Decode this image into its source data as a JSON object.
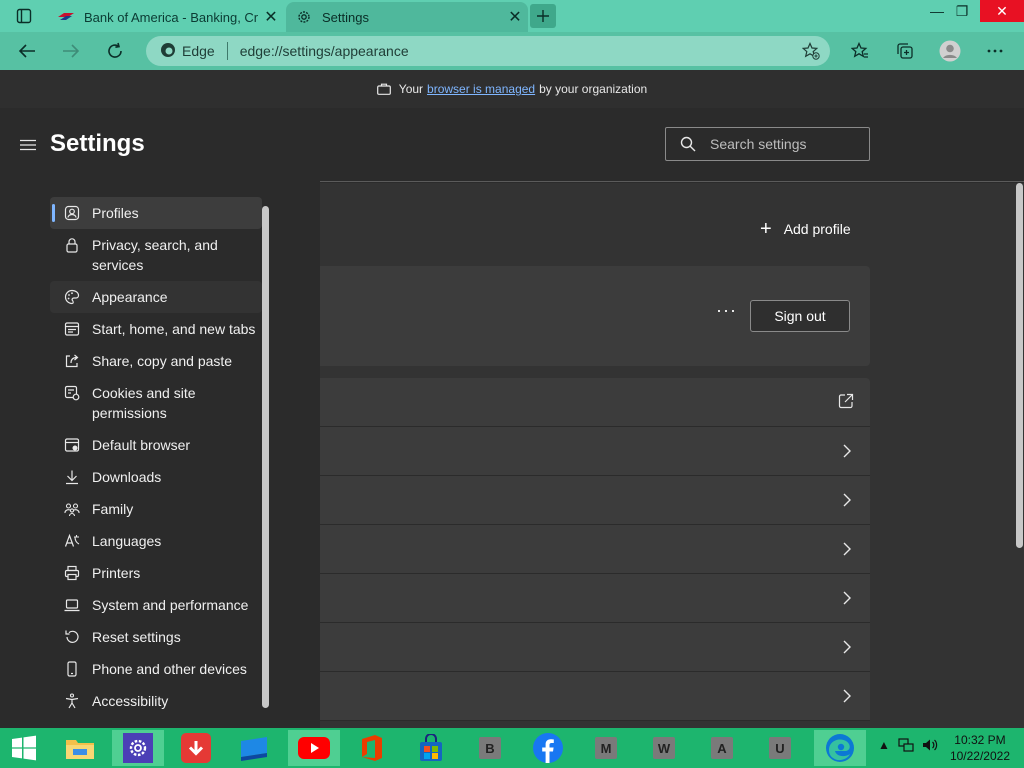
{
  "tabs": [
    {
      "title": "Bank of America - Banking, Credit Cards, Loans",
      "active": false
    },
    {
      "title": "Settings",
      "active": true
    }
  ],
  "address": {
    "brand": "Edge",
    "url": "edge://settings/appearance"
  },
  "managed_banner": {
    "prefix": "Your",
    "link": "browser is managed",
    "suffix": "by your organization"
  },
  "sidebar": {
    "title": "Settings",
    "items": [
      {
        "label": "Profiles",
        "icon": "profile-icon",
        "state": "active"
      },
      {
        "label": "Privacy, search, and services",
        "icon": "lock-icon"
      },
      {
        "label": "Appearance",
        "icon": "palette-icon",
        "state": "hover"
      },
      {
        "label": "Start, home, and new tabs",
        "icon": "start-page-icon"
      },
      {
        "label": "Share, copy and paste",
        "icon": "share-icon"
      },
      {
        "label": "Cookies and site permissions",
        "icon": "cookie-permissions-icon"
      },
      {
        "label": "Default browser",
        "icon": "default-browser-icon"
      },
      {
        "label": "Downloads",
        "icon": "download-icon"
      },
      {
        "label": "Family",
        "icon": "family-icon"
      },
      {
        "label": "Languages",
        "icon": "languages-icon"
      },
      {
        "label": "Printers",
        "icon": "printer-icon"
      },
      {
        "label": "System and performance",
        "icon": "laptop-icon"
      },
      {
        "label": "Reset settings",
        "icon": "reset-icon"
      },
      {
        "label": "Phone and other devices",
        "icon": "phone-icon"
      },
      {
        "label": "Accessibility",
        "icon": "accessibility-icon"
      }
    ]
  },
  "search": {
    "placeholder": "Search settings"
  },
  "profiles": {
    "add_label": "Add profile",
    "more_label": "···",
    "signout_label": "Sign out"
  },
  "taskbar": {
    "letters": [
      "B",
      "M",
      "W",
      "A",
      "U"
    ],
    "time": "10:32 PM",
    "date": "10/22/2022"
  },
  "colors": {
    "accent": "#5fcfb1",
    "taskbar": "#1db56e",
    "link": "#7fb6ff"
  }
}
